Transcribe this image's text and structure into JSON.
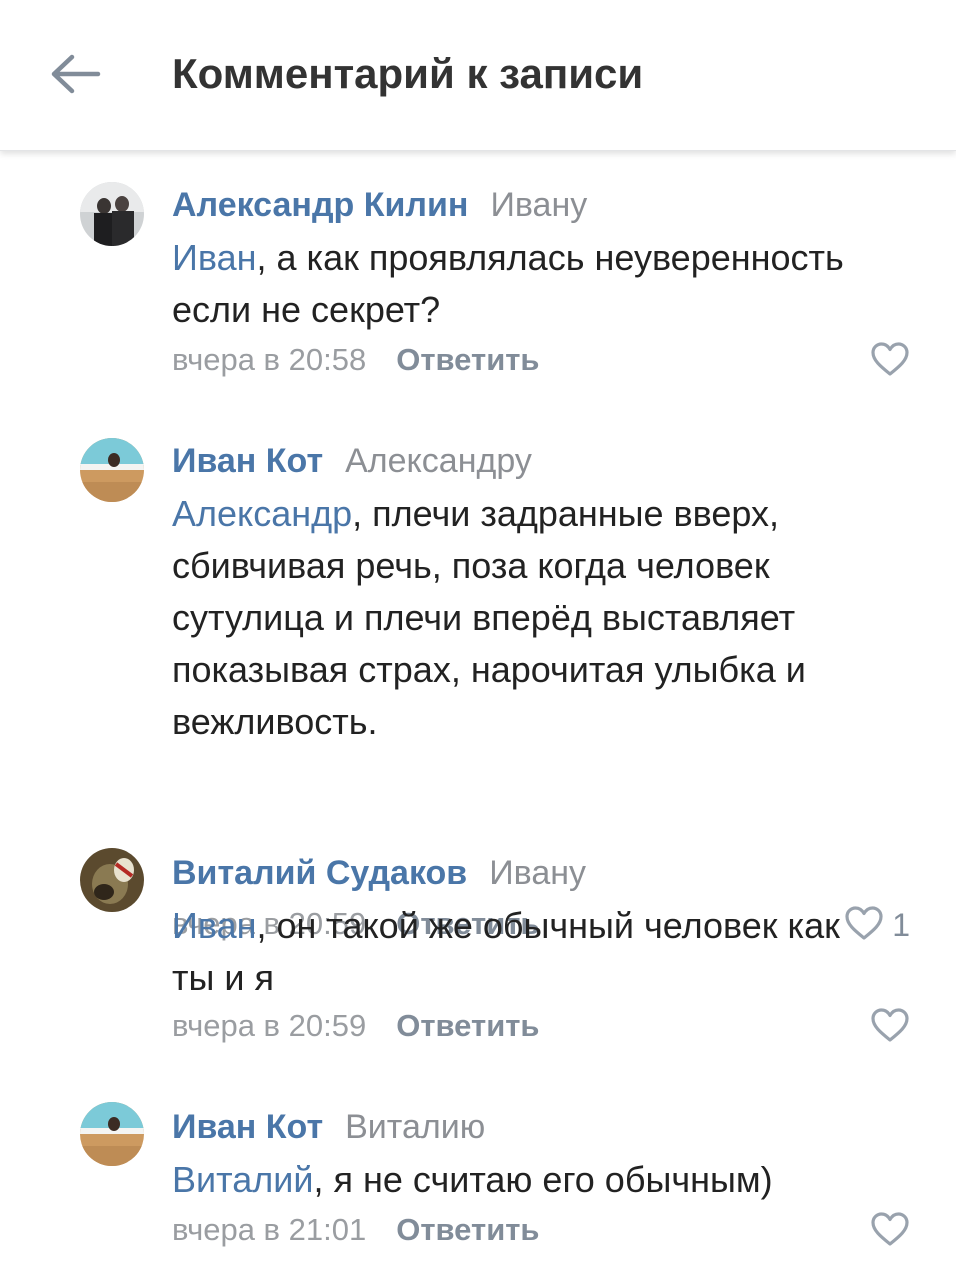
{
  "header": {
    "title": "Комментарий к записи",
    "back_icon": "arrow-left-icon"
  },
  "colors": {
    "link": "#4a76a8",
    "muted": "#9a9da1",
    "reply": "#818c99",
    "text": "#222222"
  },
  "comments": [
    {
      "author": "Александр Килин",
      "reply_to": "Ивану",
      "mention": "Иван",
      "text": ", а как проявлялась неуверенность если не секрет?",
      "time": "вчера в 20:58",
      "reply_label": "Ответить",
      "likes": ""
    },
    {
      "author": "Иван Кот",
      "reply_to": "Александру",
      "mention": "Александр",
      "text": ", плечи задранные вверх, сбивчивая речь, поза когда человек сутулица и плечи вперёд выставляет показывая страх, нарочитая улыбка и вежливость.",
      "time": "вчера в 20:59",
      "reply_label": "Ответить",
      "likes": "1"
    },
    {
      "author": "Виталий Судаков",
      "reply_to": "Ивану",
      "mention": "Иван",
      "text": ", он такой же обычный человек как ты и я",
      "time": "вчера в 20:59",
      "reply_label": "Ответить",
      "likes": ""
    },
    {
      "author": "Иван Кот",
      "reply_to": "Виталию",
      "mention": "Виталий",
      "text": ", я не считаю его обычным)",
      "time": "вчера в 21:01",
      "reply_label": "Ответить",
      "likes": ""
    }
  ]
}
